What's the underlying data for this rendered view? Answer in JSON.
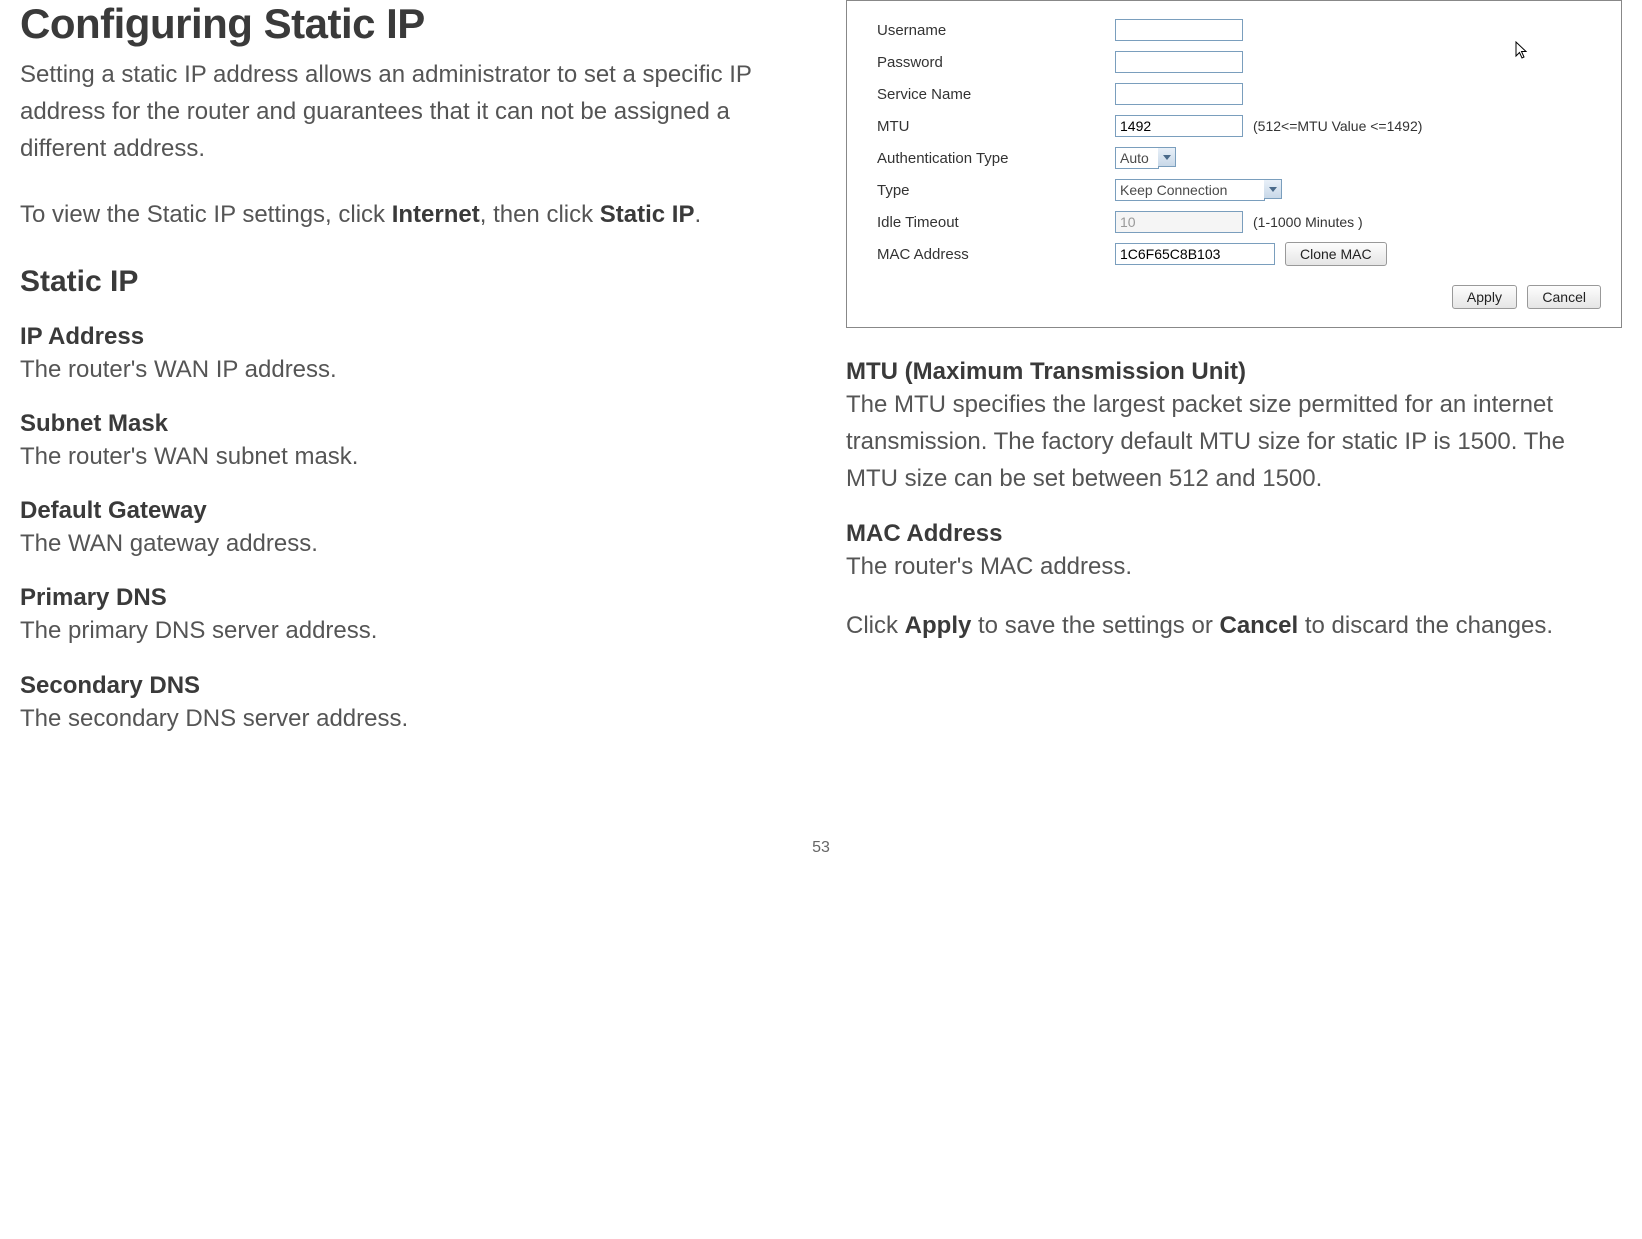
{
  "page_number": "53",
  "left": {
    "title": "Configuring Static IP",
    "intro": "Setting a static IP address allows an administrator to set a specific IP address for the router and guarantees that it can not be assigned a different address.",
    "nav_pre": "To view the Static IP settings, click ",
    "nav_b1": "Internet",
    "nav_mid": ", then click ",
    "nav_b2": "Static IP",
    "nav_post": ".",
    "section": "Static IP",
    "items": [
      {
        "term": "IP Address",
        "desc": "The router's WAN IP address."
      },
      {
        "term": "Subnet Mask",
        "desc": "The router's WAN subnet mask."
      },
      {
        "term": "Default Gateway",
        "desc": "The WAN gateway address."
      },
      {
        "term": "Primary DNS",
        "desc": "The primary DNS server address."
      },
      {
        "term": "Secondary DNS",
        "desc": "The secondary DNS server address."
      }
    ]
  },
  "panel": {
    "labels": {
      "username": "Username",
      "password": "Password",
      "service_name": "Service Name",
      "mtu": "MTU",
      "auth_type": "Authentication Type",
      "type": "Type",
      "idle_timeout": "Idle Timeout",
      "mac_address": "MAC Address"
    },
    "values": {
      "username": "",
      "password": "",
      "service_name": "",
      "mtu": "1492",
      "auth_type": "Auto",
      "type": "Keep Connection",
      "idle_timeout": "10",
      "mac_address": "1C6F65C8B103"
    },
    "hints": {
      "mtu": "(512<=MTU Value <=1492)",
      "idle_timeout": "(1-1000 Minutes )"
    },
    "buttons": {
      "clone_mac": "Clone MAC",
      "apply": "Apply",
      "cancel": "Cancel"
    }
  },
  "right": {
    "items": [
      {
        "term": "MTU (Maximum Transmission Unit)",
        "desc": "The MTU specifies the largest packet size permitted for an internet transmission. The factory default MTU size for static IP is 1500. The MTU size can be set between 512 and 1500."
      },
      {
        "term": "MAC Address",
        "desc": "The router's MAC address."
      }
    ],
    "closing_pre": "Click ",
    "closing_b1": "Apply",
    "closing_mid": " to save the settings or ",
    "closing_b2": "Cancel",
    "closing_post": " to discard the changes."
  }
}
